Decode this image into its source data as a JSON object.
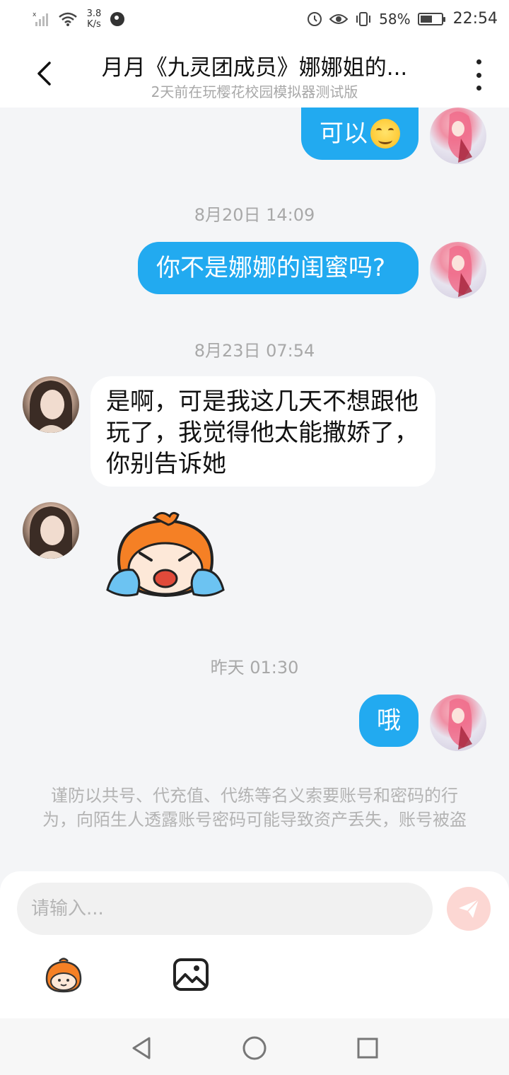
{
  "status_bar": {
    "net_speed_value": "3.8",
    "net_speed_unit": "K/s",
    "battery_percent": "58%",
    "battery_level": 0.58,
    "time": "22:54"
  },
  "header": {
    "title": "月月《九灵团成员》娜娜姐的...",
    "subtitle": "2天前在玩樱花校园模拟器测试版"
  },
  "messages": [
    {
      "side": "self",
      "text": "可以",
      "emoji": "smiling-face"
    },
    {
      "type": "time",
      "text": "8月20日 14:09"
    },
    {
      "side": "self",
      "text": "你不是娜娜的闺蜜吗?"
    },
    {
      "type": "time",
      "text": "8月23日 07:54"
    },
    {
      "side": "other",
      "text": "是啊，可是我这几天不想跟他玩了，我觉得他太能撒娇了，你别告诉她"
    },
    {
      "side": "other",
      "type": "sticker",
      "sticker": "crying-cartoon-sticker"
    },
    {
      "type": "time",
      "text": "昨天 01:30"
    },
    {
      "side": "self",
      "text": "哦"
    }
  ],
  "notice": "谨防以共号、代充值、代练等名义索要账号和密码的行为，向陌生人透露账号密码可能导致资产丢失，账号被盗",
  "input": {
    "placeholder": "请输入...",
    "value": ""
  },
  "colors": {
    "self_bubble": "#22aaf0",
    "other_bubble": "#ffffff",
    "background": "#f4f5f7",
    "send_button": "#fcd7d3"
  }
}
